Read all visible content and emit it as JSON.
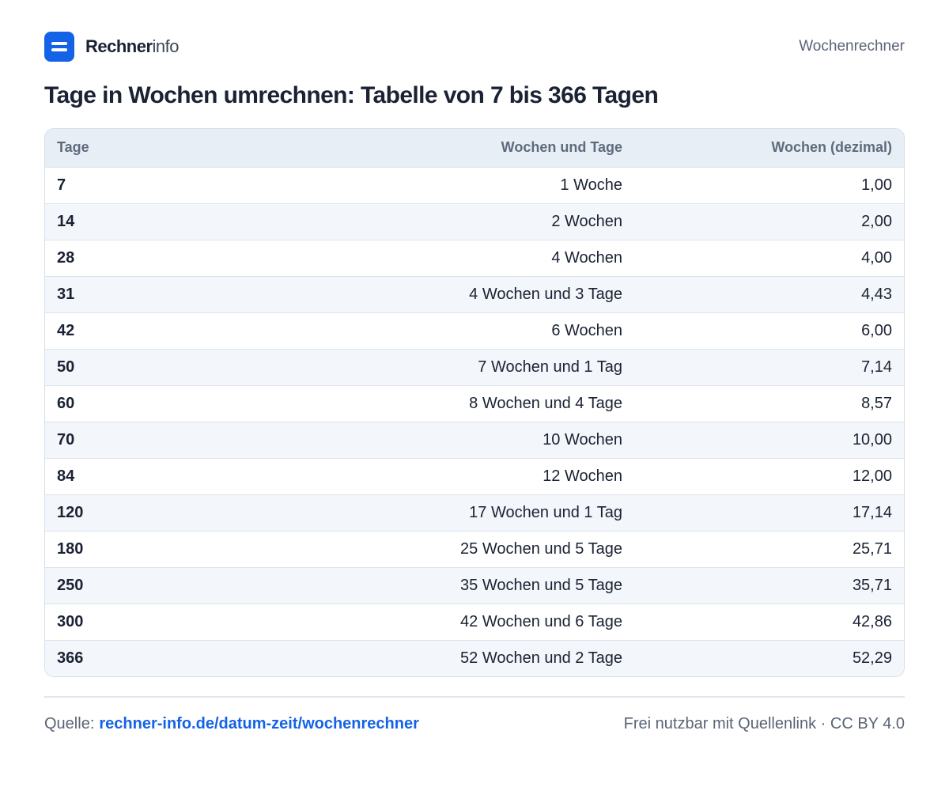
{
  "brand": {
    "name_strong": "Rechner",
    "name_light": "info"
  },
  "header": {
    "nav_link": "Wochenrechner"
  },
  "page_title": "Tage in Wochen umrechnen: Tabelle von 7 bis 366 Tagen",
  "table": {
    "headers": [
      "Tage",
      "Wochen und Tage",
      "Wochen (dezimal)"
    ],
    "rows": [
      [
        "7",
        "1 Woche",
        "1,00"
      ],
      [
        "14",
        "2 Wochen",
        "2,00"
      ],
      [
        "28",
        "4 Wochen",
        "4,00"
      ],
      [
        "31",
        "4 Wochen und 3 Tage",
        "4,43"
      ],
      [
        "42",
        "6 Wochen",
        "6,00"
      ],
      [
        "50",
        "7 Wochen und 1 Tag",
        "7,14"
      ],
      [
        "60",
        "8 Wochen und 4 Tage",
        "8,57"
      ],
      [
        "70",
        "10 Wochen",
        "10,00"
      ],
      [
        "84",
        "12 Wochen",
        "12,00"
      ],
      [
        "120",
        "17 Wochen und 1 Tag",
        "17,14"
      ],
      [
        "180",
        "25 Wochen und 5 Tage",
        "25,71"
      ],
      [
        "250",
        "35 Wochen und 5 Tage",
        "35,71"
      ],
      [
        "300",
        "42 Wochen und 6 Tage",
        "42,86"
      ],
      [
        "366",
        "52 Wochen und 2 Tage",
        "52,29"
      ]
    ]
  },
  "footer": {
    "source_label": "Quelle:",
    "source_link": "rechner-info.de/datum-zeit/wochenrechner",
    "license": "Frei nutzbar mit Quellenlink · CC BY 4.0"
  },
  "colors": {
    "accent": "#1463e6",
    "header_bg": "#e8eef6",
    "stripe_bg": "#f3f6fa",
    "text": "#1a2233",
    "muted": "#5a6475"
  }
}
